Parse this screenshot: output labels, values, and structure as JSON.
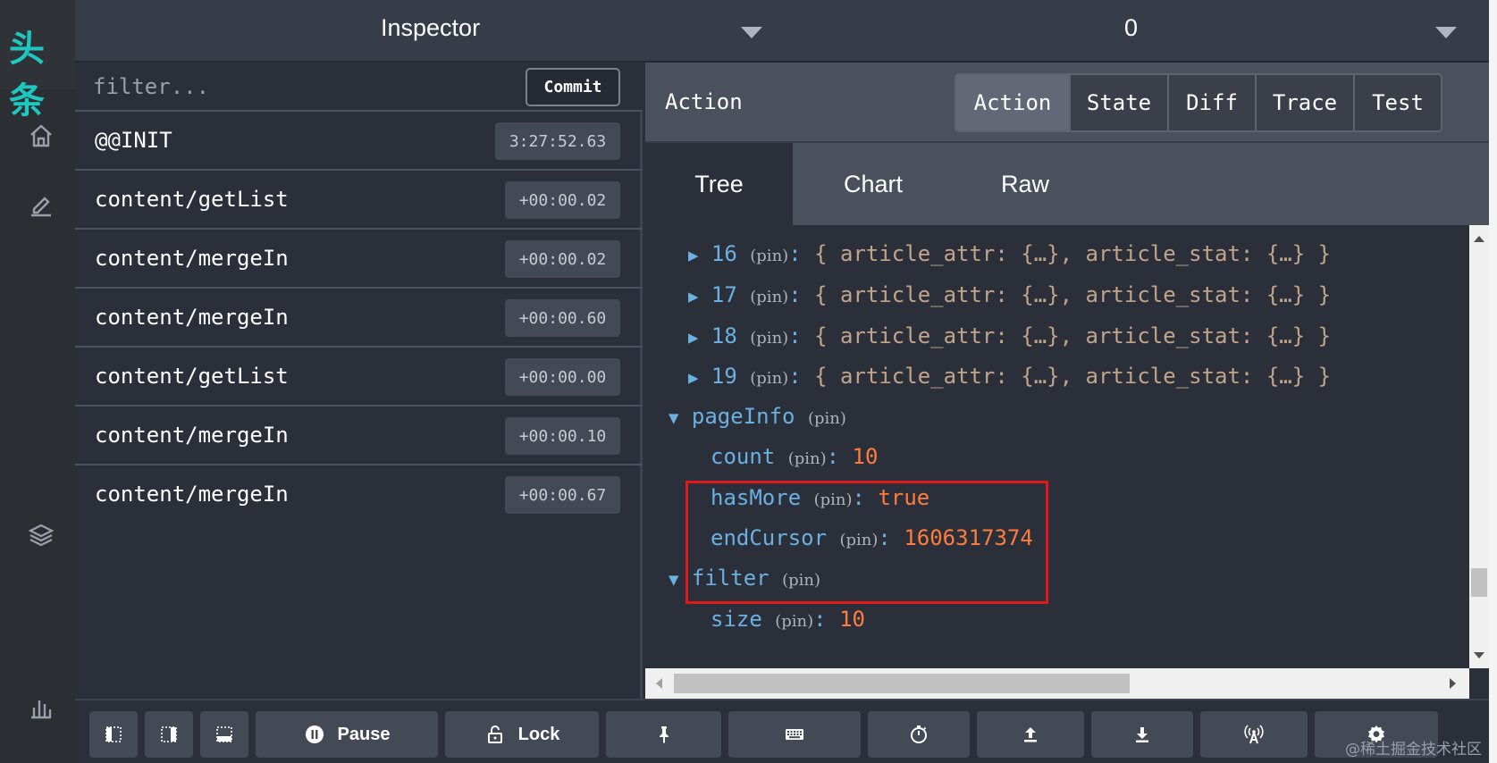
{
  "rail": {
    "logo_text": "头条",
    "icons": [
      "home-icon",
      "edit-icon",
      "layers-icon",
      "chart-icon"
    ]
  },
  "topbar": {
    "title": "Inspector",
    "zero_value": "0"
  },
  "list": {
    "filter_placeholder": "filter...",
    "commit_label": "Commit",
    "actions": [
      {
        "name": "@@INIT",
        "time": "3:27:52.63"
      },
      {
        "name": "content/getList",
        "time": "+00:00.02"
      },
      {
        "name": "content/mergeIn",
        "time": "+00:00.02"
      },
      {
        "name": "content/mergeIn",
        "time": "+00:00.60"
      },
      {
        "name": "content/getList",
        "time": "+00:00.00"
      },
      {
        "name": "content/mergeIn",
        "time": "+00:00.10"
      },
      {
        "name": "content/mergeIn",
        "time": "+00:00.67"
      }
    ]
  },
  "inspector": {
    "label": "Action",
    "modes": [
      "Action",
      "State",
      "Diff",
      "Trace",
      "Test"
    ],
    "tabs": [
      "Tree",
      "Chart",
      "Raw"
    ],
    "pin": "(pin)",
    "items": [
      {
        "index": "16",
        "value": "{ article_attr: {…}, article_stat: {…} }"
      },
      {
        "index": "17",
        "value": "{ article_attr: {…}, article_stat: {…} }"
      },
      {
        "index": "18",
        "value": "{ article_attr: {…}, article_stat: {…} }"
      },
      {
        "index": "19",
        "value": "{ article_attr: {…}, article_stat: {…} }"
      }
    ],
    "pageInfo": {
      "key": "pageInfo",
      "count_key": "count",
      "count_val": "10",
      "hasMore_key": "hasMore",
      "hasMore_val": "true",
      "endCursor_key": "endCursor",
      "endCursor_val": "1606317374"
    },
    "filter": {
      "key": "filter",
      "size_key": "size",
      "size_val": "10"
    }
  },
  "toolbar": {
    "pause_label": "Pause",
    "lock_label": "Lock",
    "icons": [
      "dock-left-icon",
      "dock-right-icon",
      "dock-bottom-icon",
      "pause-icon",
      "lock-icon",
      "pin-icon",
      "keyboard-icon",
      "timer-icon",
      "upload-icon",
      "download-icon",
      "remote-icon",
      "settings-icon"
    ]
  },
  "watermark": "@稀土掘金技术社区"
}
